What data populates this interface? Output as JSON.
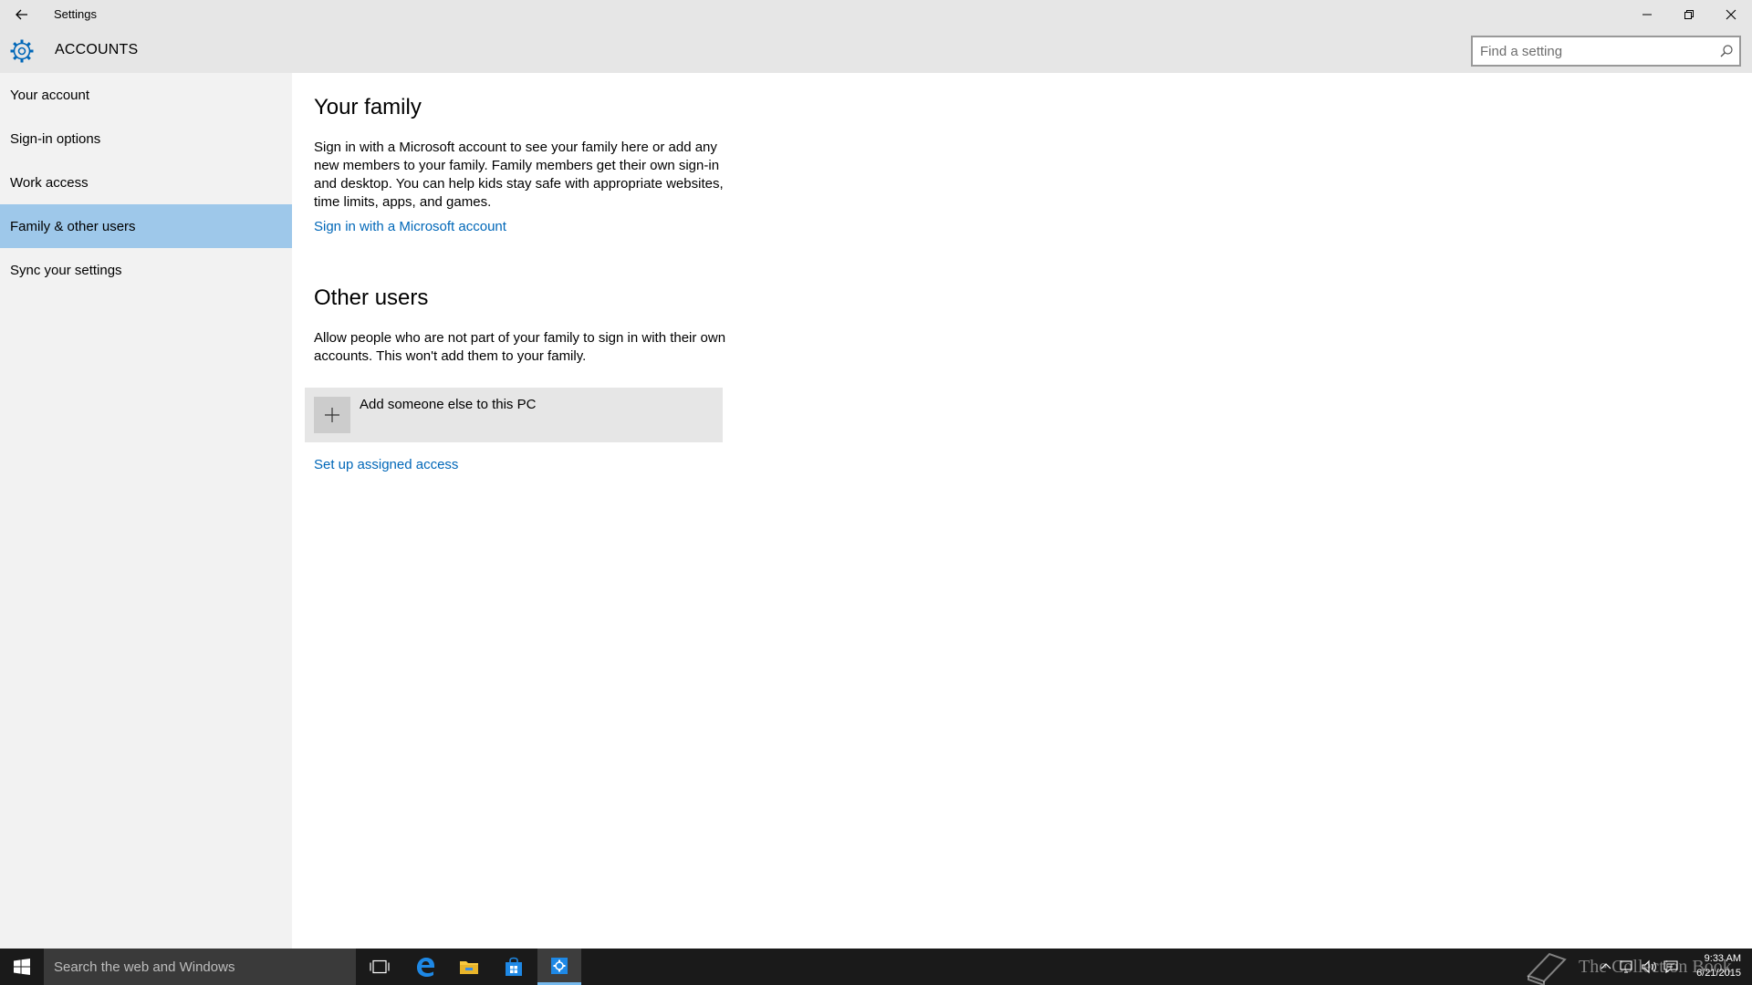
{
  "window": {
    "title": "Settings"
  },
  "header": {
    "section_title": "ACCOUNTS",
    "search_placeholder": "Find a setting"
  },
  "sidebar": {
    "items": [
      {
        "label": "Your account",
        "active": false
      },
      {
        "label": "Sign-in options",
        "active": false
      },
      {
        "label": "Work access",
        "active": false
      },
      {
        "label": "Family & other users",
        "active": true
      },
      {
        "label": "Sync your settings",
        "active": false
      }
    ]
  },
  "main": {
    "family": {
      "heading": "Your family",
      "description": "Sign in with a Microsoft account to see your family here or add any new members to your family. Family members get their own sign-in and desktop. You can help kids stay safe with appropriate websites, time limits, apps, and games.",
      "link": "Sign in with a Microsoft account"
    },
    "other_users": {
      "heading": "Other users",
      "description": "Allow people who are not part of your family to sign in with their own accounts. This won't add them to your family.",
      "add_button": "Add someone else to this PC",
      "link": "Set up assigned access"
    }
  },
  "taskbar": {
    "search_text": "Search the web and Windows",
    "clock_time": "9:33 AM",
    "clock_date": "6/21/2015",
    "watermark": "The Collection Book"
  },
  "colors": {
    "accent": "#0067b8",
    "active_nav": "#9ec8ea",
    "chrome": "#e6e6e6",
    "sidebar": "#f2f2f2",
    "taskbar": "#1a1a1a"
  }
}
